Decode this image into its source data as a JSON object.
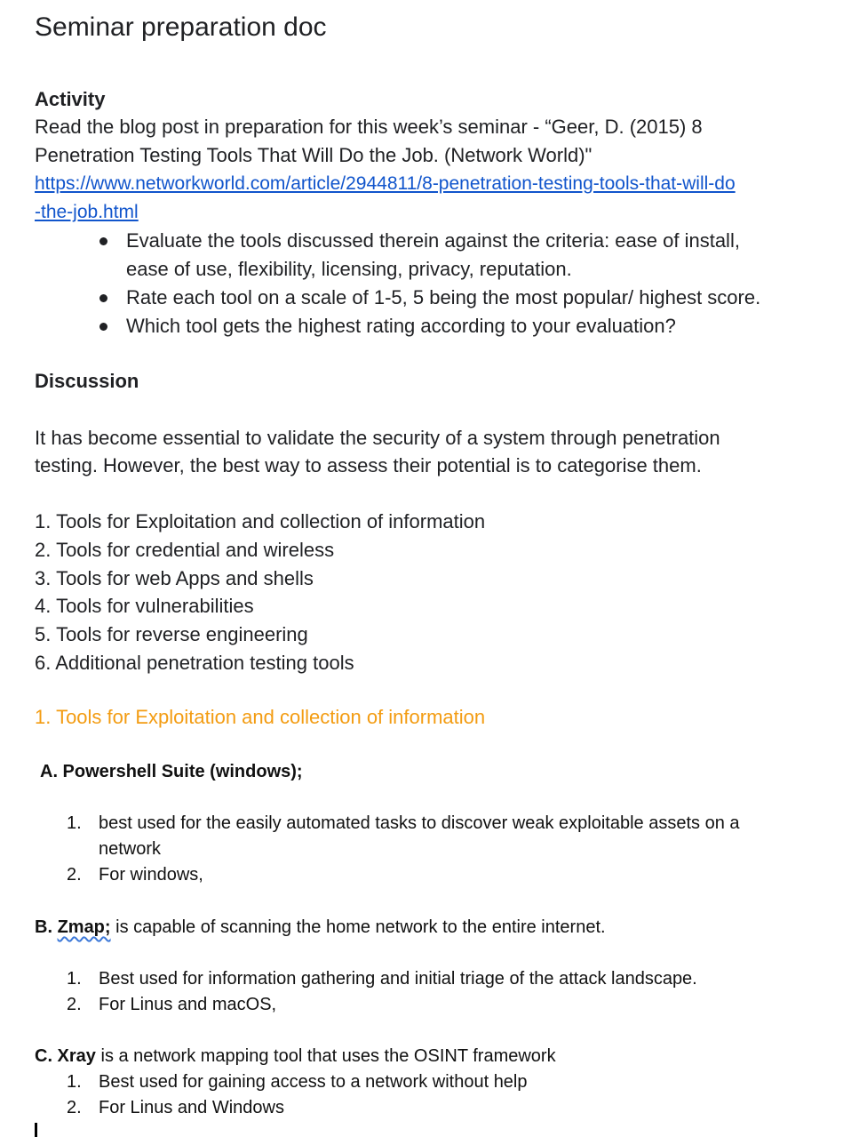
{
  "doc_title": "Seminar preparation doc",
  "activity": {
    "heading": "Activity",
    "intro_line1": "Read the blog post in preparation for this week’s seminar - “Geer, D. (2015) 8",
    "intro_line2": "Penetration Testing Tools That Will Do the Job. (Network World)\"",
    "link_line1": "https://www.networkworld.com/article/2944811/8-penetration-testing-tools-that-will-do",
    "link_line2": "-the-job.html",
    "bullets": [
      "Evaluate the tools discussed therein against the criteria: ease of install,",
      "ease of use, flexibility, licensing, privacy, reputation.",
      "Rate each tool on a scale of 1-5, 5 being the most popular/ highest score.",
      "Which tool gets the highest rating according to your evaluation?"
    ]
  },
  "discussion": {
    "heading": "Discussion",
    "para_line1": "It has become essential to validate the security of a system through penetration",
    "para_line2": "testing. However, the best way to assess their potential is to categorise them.",
    "categories": [
      "1. Tools for Exploitation and collection of information",
      "2. Tools for credential and wireless",
      "3. Tools for web Apps and shells",
      "4. Tools for vulnerabilities",
      "5. Tools for reverse engineering",
      "6. Additional penetration testing tools"
    ],
    "section_heading": "1. Tools for Exploitation and collection of information"
  },
  "tools": {
    "a": {
      "title": "A. Powershell Suite (windows);",
      "items": [
        {
          "num": "1.",
          "line1": "best used for the easily automated tasks to discover weak exploitable assets on a",
          "line2": "network"
        },
        {
          "num": "2.",
          "line1": "For windows,"
        }
      ]
    },
    "b": {
      "prefix": "B. ",
      "name": "Zmap;",
      "rest": " is capable of scanning the home network to the entire internet.",
      "items": [
        {
          "num": "1.",
          "text": "Best used for information gathering and initial triage of the attack landscape."
        },
        {
          "num": "2.",
          "text": "For Linus and macOS,"
        }
      ]
    },
    "c": {
      "prefix": "C. Xray",
      "rest": " is a network mapping tool that uses the OSINT framework",
      "items": [
        {
          "num": "1.",
          "text": "Best used for gaining access to a network without help"
        },
        {
          "num": "2.",
          "text": "For Linus and Windows"
        }
      ]
    }
  }
}
